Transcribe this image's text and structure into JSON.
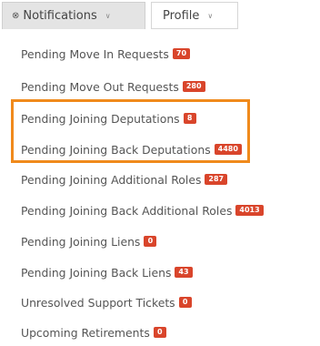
{
  "tabs": {
    "notifications": {
      "label": "Notifications",
      "icon": "bell-icon"
    },
    "profile": {
      "label": "Profile"
    }
  },
  "menu": {
    "items": [
      {
        "label": "Pending Move In Requests",
        "badge": "70"
      },
      {
        "label": "Pending Move Out Requests",
        "badge": "280"
      },
      {
        "label": "Pending Joining Deputations",
        "badge": "8"
      },
      {
        "label": "Pending Joining Back Deputations",
        "badge": "4480"
      },
      {
        "label": "Pending Joining Additional Roles",
        "badge": "287"
      },
      {
        "label": "Pending Joining Back Additional Roles",
        "badge": "4013"
      },
      {
        "label": "Pending Joining Liens",
        "badge": "0"
      },
      {
        "label": "Pending Joining Back Liens",
        "badge": "43"
      },
      {
        "label": "Unresolved Support Tickets",
        "badge": "0"
      },
      {
        "label": "Upcoming Retirements",
        "badge": "0"
      }
    ]
  },
  "colors": {
    "badge": "#d9452b",
    "highlight": "#f08a1c",
    "text": "#555555"
  }
}
